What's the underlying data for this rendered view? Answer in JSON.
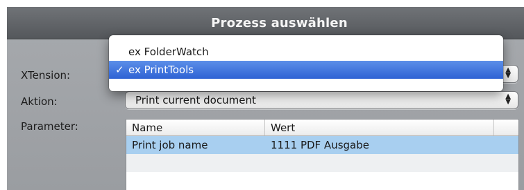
{
  "dialog": {
    "title": "Prozess auswählen"
  },
  "form": {
    "xtension_label": "XTension:",
    "aktion_label": "Aktion:",
    "aktion_value": "Print current document",
    "parameter_label": "Parameter:"
  },
  "dropdown": {
    "items": [
      {
        "label": "ex FolderWatch",
        "selected": false
      },
      {
        "label": "ex PrintTools",
        "selected": true
      }
    ],
    "check_glyph": "✓"
  },
  "parameters_table": {
    "columns": [
      "Name",
      "Wert"
    ],
    "rows": [
      {
        "name": "Print job name",
        "wert": "1111 PDF Ausgabe"
      }
    ]
  },
  "colors": {
    "selection_blue": "#2e62d4",
    "row_selection": "#a8cff0",
    "titlebar": "#5e6165"
  }
}
